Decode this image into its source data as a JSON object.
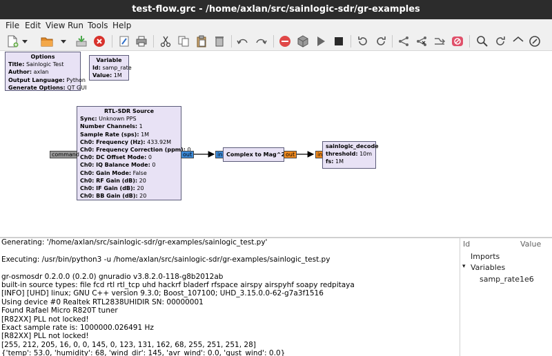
{
  "window": {
    "title": "test-flow.grc - /home/axlan/src/sainlogic-sdr/gr-examples"
  },
  "menu": [
    "File",
    "Edit",
    "View",
    "Run",
    "Tools",
    "Help"
  ],
  "toolbar": {
    "icons": [
      "new-icon",
      "dropdown-arrow-icon",
      "open-icon",
      "dropdown-arrow-icon",
      "save-icon",
      "close-icon",
      "edit-icon",
      "print-icon",
      "cut-icon",
      "copy-icon",
      "paste-icon",
      "delete-icon",
      "undo-icon",
      "redo-icon",
      "stop-sign-icon",
      "generate-icon",
      "execute-icon",
      "kill-icon",
      "rotate-ccw-icon",
      "rotate-cw-icon",
      "enable-icon",
      "disable-icon",
      "bypass-icon",
      "find-icon",
      "reload-icon",
      "help-icon"
    ]
  },
  "blocks": {
    "options": {
      "title": "Options",
      "params": [
        {
          "k": "Title:",
          "v": "Sainlogic Test"
        },
        {
          "k": "Author:",
          "v": "axlan"
        },
        {
          "k": "Output Language:",
          "v": "Python"
        },
        {
          "k": "Generate Options:",
          "v": "QT GUI"
        }
      ]
    },
    "variable": {
      "title": "Variable",
      "params": [
        {
          "k": "Id:",
          "v": "samp_rate"
        },
        {
          "k": "Value:",
          "v": "1M"
        }
      ]
    },
    "rtlsdr": {
      "title": "RTL-SDR Source",
      "params": [
        {
          "k": "Sync:",
          "v": "Unknown PPS"
        },
        {
          "k": "Number Channels:",
          "v": "1"
        },
        {
          "k": "Sample Rate (sps):",
          "v": "1M"
        },
        {
          "k": "Ch0: Frequency (Hz):",
          "v": "433.92M"
        },
        {
          "k": "Ch0: Frequency Correction (ppm):",
          "v": "0"
        },
        {
          "k": "Ch0: DC Offset Mode:",
          "v": "0"
        },
        {
          "k": "Ch0: IQ Balance Mode:",
          "v": "0"
        },
        {
          "k": "Ch0: Gain Mode:",
          "v": "False"
        },
        {
          "k": "Ch0: RF Gain (dB):",
          "v": "20"
        },
        {
          "k": "Ch0: IF Gain (dB):",
          "v": "20"
        },
        {
          "k": "Ch0: BB Gain (dB):",
          "v": "20"
        }
      ],
      "port_in": "command",
      "port_out": "out"
    },
    "complex": {
      "title": "Complex to Mag^2",
      "port_in": "in",
      "port_out": "out"
    },
    "decode": {
      "title": "sainlogic_decode",
      "params": [
        {
          "k": "threshold:",
          "v": "10m"
        },
        {
          "k": "fs:",
          "v": "1M"
        }
      ],
      "port_in": "in"
    }
  },
  "console": [
    "Generating: '/home/axlan/src/sainlogic-sdr/gr-examples/sainlogic_test.py'",
    "",
    "Executing: /usr/bin/python3 -u /home/axlan/src/sainlogic-sdr/gr-examples/sainlogic_test.py",
    "",
    "gr-osmosdr 0.2.0.0 (0.2.0) gnuradio v3.8.2.0-118-g8b2012ab",
    "built-in source types: file fcd rtl rtl_tcp uhd hackrf bladerf rfspace airspy airspyhf soapy redpitaya",
    "[INFO] [UHD] linux; GNU C++ version 9.3.0; Boost_107100; UHD_3.15.0.0-62-g7a3f1516",
    "Using device #0 Realtek RTL2838UHIDIR SN: 00000001",
    "Found Rafael Micro R820T tuner",
    "[R82XX] PLL not locked!",
    "Exact sample rate is: 1000000.026491 Hz",
    "[R82XX] PLL not locked!",
    "[255, 212, 205, 16, 0, 0, 145, 0, 123, 131, 162, 68, 255, 251, 251, 28]",
    "{'temp': 53.0, 'humidity': 68, 'wind_dir': 145, 'avr_wind': 0.0, 'gust_wind': 0.0}"
  ],
  "variables_panel": {
    "col_id": "Id",
    "col_value": "Value",
    "imports": "Imports",
    "variables": "Variables",
    "var_name": "samp_rate",
    "var_value": "1e6"
  }
}
